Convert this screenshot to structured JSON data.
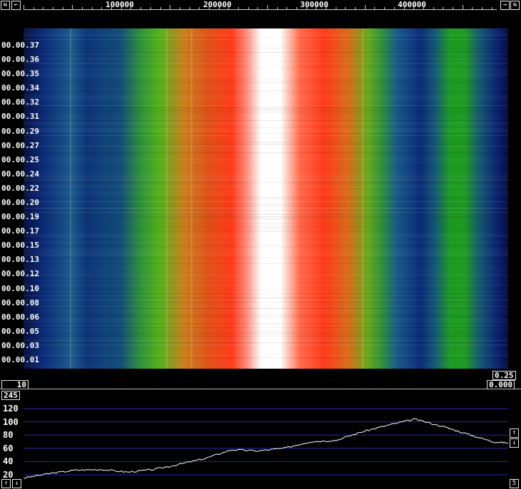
{
  "freq_ruler": {
    "labels": [
      "100000",
      "200000",
      "300000",
      "400000"
    ],
    "left_buttons": [
      "⇆",
      "←"
    ],
    "right_buttons": [
      "→",
      "⇆"
    ]
  },
  "waterfall": {
    "time_labels": [
      "00.00.37",
      "00.00.36",
      "00.00.35",
      "00.00.34",
      "00.00.32",
      "00.00.31",
      "00.00.29",
      "00.00.27",
      "00.00.25",
      "00.00.24",
      "00.00.22",
      "00.00.20",
      "00.00.19",
      "00.00.17",
      "00.00.15",
      "00.00.13",
      "00.00.12",
      "00.00.10",
      "00.00.08",
      "00.00.06",
      "00.00.05",
      "00.00.03",
      "00.00.01"
    ],
    "colors": {
      "low": "#0a1f6e",
      "mid": "#1a9a12",
      "high": "#ff3a1a",
      "peak": "#ffffff"
    }
  },
  "controls": {
    "gain_value": "10",
    "speed_value": "0.25",
    "offset_value": "0.000",
    "level_value": "245",
    "bottom_right_value": "5"
  },
  "spectrum": {
    "y_ticks": [
      "120",
      "100",
      "80",
      "60",
      "40",
      "20"
    ],
    "line_color": "#ffffff",
    "grid_color": "#1d2fb0"
  },
  "chart_data": {
    "type": "line",
    "title": "",
    "xlabel": "",
    "ylabel": "",
    "ylim": [
      15,
      125
    ],
    "x": [
      0,
      25000,
      50000,
      75000,
      100000,
      125000,
      150000,
      175000,
      200000,
      225000,
      250000,
      275000,
      300000,
      325000,
      350000,
      375000,
      400000,
      425000,
      450000,
      465000
    ],
    "series": [
      {
        "values": [
          15,
          22,
          27,
          28,
          24,
          28,
          36,
          45,
          58,
          56,
          60,
          70,
          72,
          85,
          95,
          104,
          94,
          82,
          70,
          68
        ]
      }
    ]
  }
}
